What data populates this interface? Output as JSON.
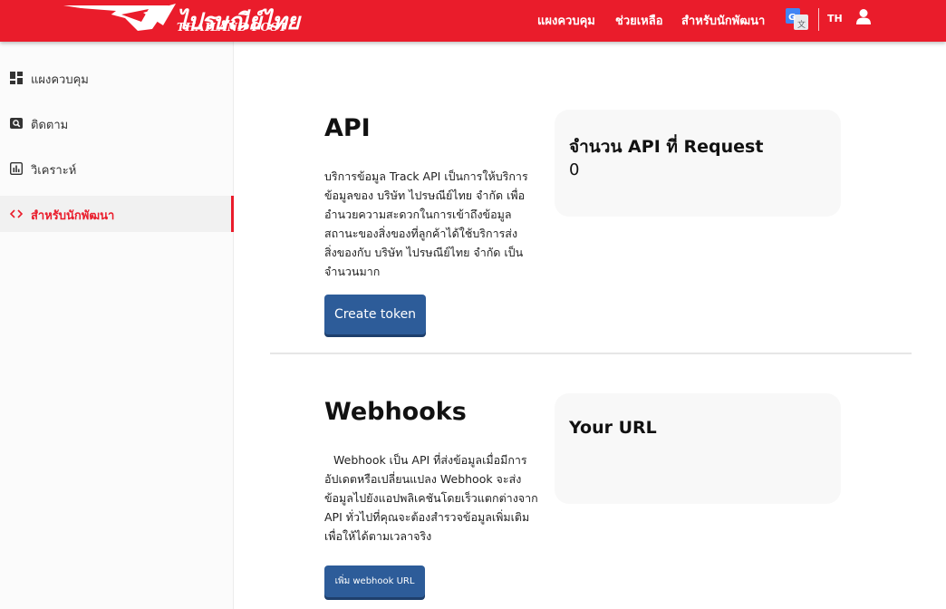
{
  "header": {
    "logo_script": "ไปรษณีย์ไทย",
    "logo_sub": "THAILAND POST",
    "nav": [
      {
        "label": "แผงควบคุม"
      },
      {
        "label": "ช่วยเหลือ"
      },
      {
        "label": "สำหรับนักพัฒนา"
      }
    ],
    "translate_icon": "google-translate-icon",
    "lang": "TH",
    "user_icon": "user-icon"
  },
  "sidebar": {
    "items": [
      {
        "label": "แผงควบคุม",
        "icon": "dashboard-icon",
        "active": false
      },
      {
        "label": "ติดตาม",
        "icon": "search-track-icon",
        "active": false
      },
      {
        "label": "วิเคราะห์",
        "icon": "bar-chart-icon",
        "active": false
      },
      {
        "label": "สำหรับนักพัฒนา",
        "icon": "code-icon",
        "active": true
      }
    ]
  },
  "api_section": {
    "title": "API",
    "description": "บริการข้อมูล Track API เป็นการให้บริการข้อมูลของ บริษัท ไปรษณีย์ไทย จำกัด เพื่ออำนวยความสะดวกในการเข้าถึงข้อมูลสถานะของสิ่งของที่ลูกค้าได้ใช้บริการส่งสิ่งของกับ บริษัท ไปรษณีย์ไทย จำกัด เป็นจำนวนมาก",
    "button_label": "Create token",
    "card_title": "จำนวน API ที่ Request",
    "card_value": "0"
  },
  "webhooks_section": {
    "title": "Webhooks",
    "description": "Webhook เป็น API ที่ส่งข้อมูลเมื่อมีการอัปเดตหรือเปลี่ยนแปลง Webhook จะส่งข้อมูลไปยังแอปพลิเคชันโดยเร็วแตกต่างจาก API ทั่วไปที่คุณจะต้องสำรวจข้อมูลเพิ่มเติมเพื่อให้ได้ตามเวลาจริง",
    "button_label": "เพิ่ม webhook URL",
    "card_title": "Your URL"
  },
  "colors": {
    "brand_red": "#ea1c2b",
    "button_blue": "#2d5c99"
  }
}
